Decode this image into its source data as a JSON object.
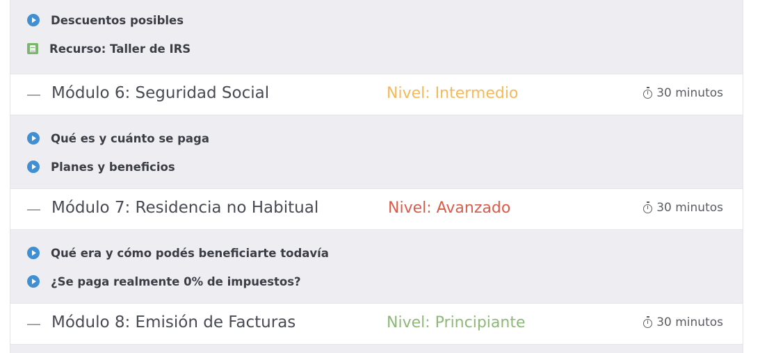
{
  "group5_lessons": [
    {
      "label": "Descuentos posibles",
      "icon": "play-icon"
    },
    {
      "label": "Recurso: Taller de IRS",
      "icon": "document-icon"
    }
  ],
  "modules": [
    {
      "title": "Módulo 6: Seguridad Social",
      "level": "Nivel: Intermedio",
      "level_color": "#f4b95a",
      "duration": "30 minutos",
      "lessons": [
        {
          "label": "Qué es y cuánto se paga",
          "icon": "play-icon"
        },
        {
          "label": "Planes y beneficios",
          "icon": "play-icon"
        }
      ]
    },
    {
      "title": "Módulo 7: Residencia no Habitual",
      "level": "Nivel: Avanzado",
      "level_color": "#d85c4a",
      "duration": "30 minutos",
      "lessons": [
        {
          "label": "Qué era y cómo podés beneficiarte todavía",
          "icon": "play-icon"
        },
        {
          "label": "¿Se paga realmente 0% de impuestos?",
          "icon": "play-icon"
        }
      ]
    },
    {
      "title": "Módulo 8: Emisión de Facturas",
      "level": "Nivel: Principiante",
      "level_color": "#8db878",
      "duration": "30 minutos",
      "lessons": []
    }
  ]
}
